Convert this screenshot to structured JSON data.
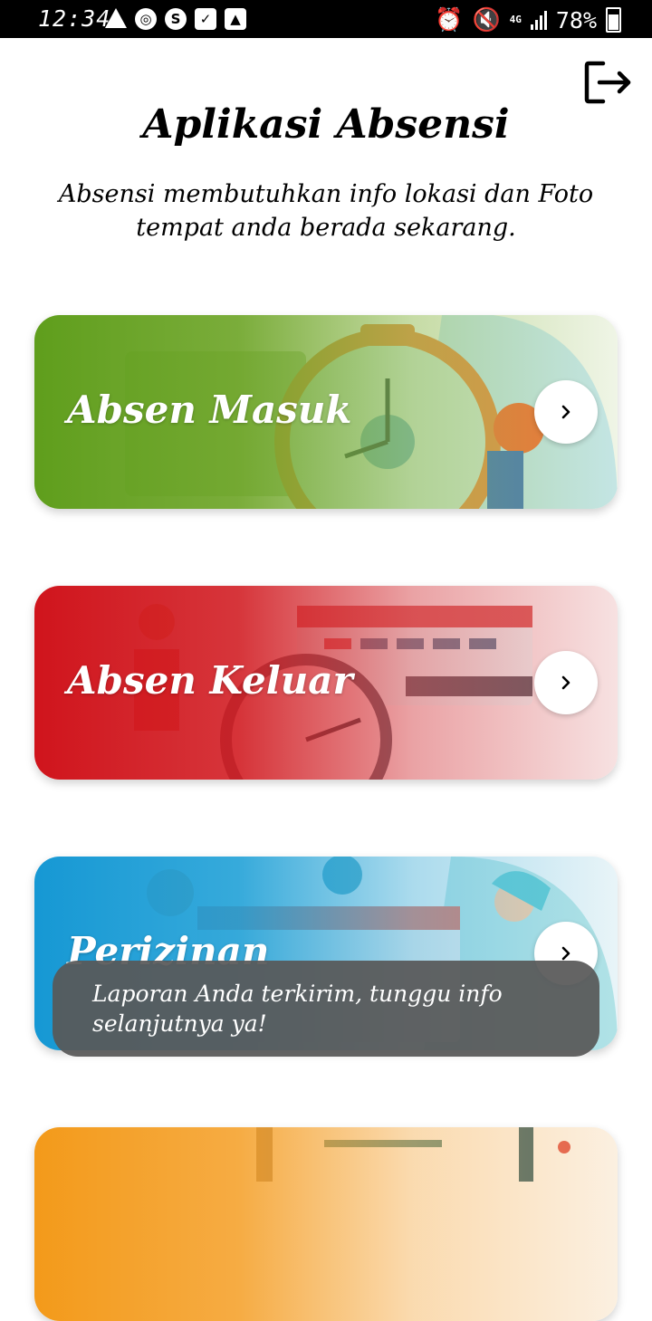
{
  "status_bar": {
    "time": "12:34",
    "network": "4G",
    "battery": "78%",
    "left_icons": [
      "warning-icon",
      "globe-icon",
      "s-app-icon",
      "checkbox-icon",
      "image-icon"
    ],
    "right_icons": [
      "alarm-icon",
      "mute-icon",
      "signal-icon",
      "battery-icon"
    ]
  },
  "header": {
    "title": "Aplikasi Absensi",
    "subtitle": "Absensi membutuhkan info lokasi dan Foto tempat anda berada sekarang."
  },
  "menu": [
    {
      "label": "Absen Masuk",
      "color": "#5f9e1c"
    },
    {
      "label": "Absen Keluar",
      "color": "#d0141c"
    },
    {
      "label": "Perizinan",
      "color": "#1698d4"
    },
    {
      "label": "",
      "color": "#f39a1a"
    }
  ],
  "toast": {
    "message": "Laporan Anda terkirim, tunggu info selanjutnya ya!"
  },
  "colors": {
    "background": "#ffffff",
    "status_bar": "#000000",
    "toast_bg": "#585858"
  }
}
